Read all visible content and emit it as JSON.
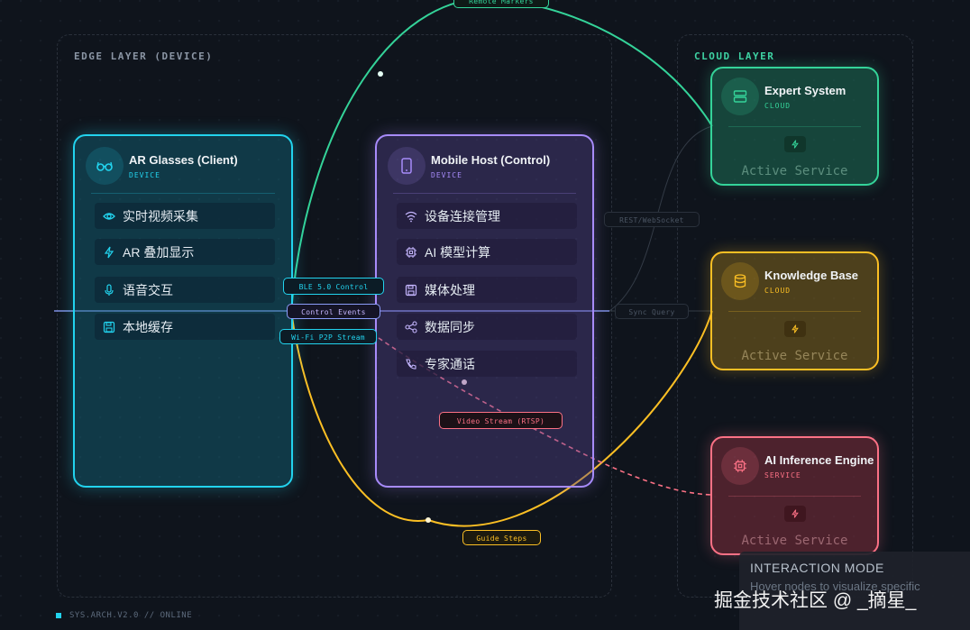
{
  "layers": {
    "edge_title": "EDGE LAYER (DEVICE)",
    "cloud_title": "CLOUD LAYER"
  },
  "nodes": {
    "ar_glasses": {
      "title": "AR Glasses (Client)",
      "subtitle": "DEVICE",
      "icon": "glasses-icon",
      "color": "#22d3ee",
      "features": [
        {
          "label": "实时视频采集",
          "icon": "eye-icon"
        },
        {
          "label": "AR 叠加显示",
          "icon": "bolt-icon"
        },
        {
          "label": "语音交互",
          "icon": "mic-icon"
        },
        {
          "label": "本地缓存",
          "icon": "save-icon"
        }
      ]
    },
    "mobile_host": {
      "title": "Mobile Host (Control)",
      "subtitle": "DEVICE",
      "icon": "phone-icon",
      "color": "#a78bfa",
      "features": [
        {
          "label": "设备连接管理",
          "icon": "wifi-icon"
        },
        {
          "label": "AI 模型计算",
          "icon": "chip-icon"
        },
        {
          "label": "媒体处理",
          "icon": "save-icon"
        },
        {
          "label": "数据同步",
          "icon": "share-icon"
        },
        {
          "label": "专家通话",
          "icon": "phone-call-icon"
        }
      ]
    },
    "expert_system": {
      "title": "Expert System",
      "subtitle": "CLOUD",
      "icon": "server-icon",
      "color": "#34d399",
      "status": "Active Service"
    },
    "knowledge_base": {
      "title": "Knowledge Base",
      "subtitle": "CLOUD",
      "icon": "database-icon",
      "color": "#fbbf24",
      "status": "Active Service"
    },
    "ai_engine": {
      "title": "AI Inference Engine",
      "subtitle": "SERVICE",
      "icon": "cpu-icon",
      "color": "#fb7185",
      "status": "Active Service"
    }
  },
  "edges": {
    "remote_markers": "Remote Markers",
    "ble_control": "BLE 5.0 Control",
    "control_events": "Control Events",
    "wifi_p2p": "Wi-Fi P2P Stream",
    "rest_websocket": "REST/WebSocket",
    "sync_query": "Sync Query",
    "video_stream": "Video Stream (RTSP)",
    "guide_steps": "Guide Steps"
  },
  "footer": "SYS.ARCH.V2.0 // ONLINE",
  "interaction_panel": {
    "title": "INTERACTION MODE",
    "text": "Hover nodes to visualize specific"
  },
  "watermark": "掘金技术社区 @ _摘星_"
}
